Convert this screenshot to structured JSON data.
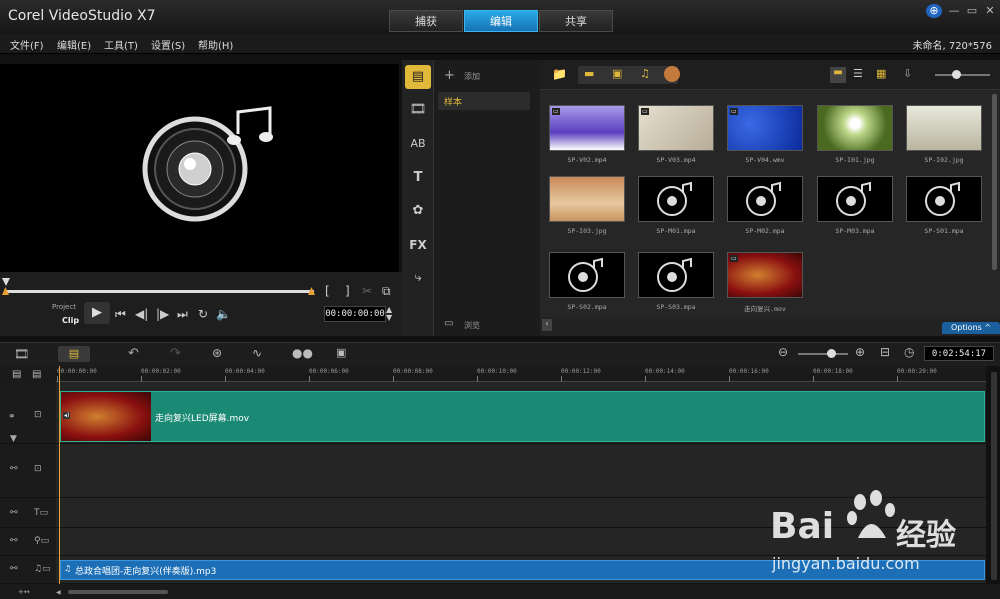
{
  "app": {
    "title": "Corel VideoStudio X7",
    "project_info": "未命名, 720*576"
  },
  "tabs": [
    {
      "label": "捕获",
      "active": false
    },
    {
      "label": "编辑",
      "active": true
    },
    {
      "label": "共享",
      "active": false
    }
  ],
  "menu": [
    "文件(F)",
    "编辑(E)",
    "工具(T)",
    "设置(S)",
    "帮助(H)"
  ],
  "player": {
    "project_label": "Project",
    "clip_label": "Clip",
    "timecode": "00:00:00:00",
    "trim_in": "[",
    "trim_out": "]"
  },
  "library": {
    "add_label": "添加",
    "folder_sample": "样本",
    "browse_label": "浏览",
    "options_label": "Options ^",
    "items": [
      {
        "caption": "SP-V02.mp4",
        "kind": "video",
        "theme": "violet"
      },
      {
        "caption": "SP-V03.mp4",
        "kind": "video",
        "theme": "beige"
      },
      {
        "caption": "SP-V04.wmv",
        "kind": "video",
        "theme": "blue"
      },
      {
        "caption": "SP-I01.jpg",
        "kind": "image",
        "theme": "dandelion"
      },
      {
        "caption": "SP-I02.jpg",
        "kind": "image",
        "theme": "tree"
      },
      {
        "caption": "SP-I03.jpg",
        "kind": "image",
        "theme": "desert"
      },
      {
        "caption": "SP-M01.mpa",
        "kind": "audio",
        "theme": "music"
      },
      {
        "caption": "SP-M02.mpa",
        "kind": "audio",
        "theme": "music"
      },
      {
        "caption": "SP-M03.mpa",
        "kind": "audio",
        "theme": "music"
      },
      {
        "caption": "SP-S01.mpa",
        "kind": "audio",
        "theme": "music"
      },
      {
        "caption": "SP-S02.mpa",
        "kind": "audio",
        "theme": "music"
      },
      {
        "caption": "SP-S03.mpa",
        "kind": "audio",
        "theme": "music"
      },
      {
        "caption": "走向复兴.mov",
        "kind": "video",
        "theme": "red"
      }
    ]
  },
  "timeline": {
    "duration": "0:02:54:17",
    "ticks": [
      "00:00:00:00",
      "00:00:02:00",
      "00:00:04:00",
      "00:00:06:00",
      "00:00:08:00",
      "00:00:10:00",
      "00:00:12:00",
      "00:00:14:00",
      "00:00:16:00",
      "00:00:18:00",
      "00:00:20:00"
    ],
    "video_clip": "走向复兴LED屏幕.mov",
    "audio_clip": "总政合唱团-走向复兴(伴奏版).mp3"
  },
  "watermark": {
    "brand": "Bai",
    "brand2": "经验",
    "url": "jingyan.baidu.com"
  },
  "colors": {
    "accent": "#1e8fd6",
    "video_clip": "#1b8a74",
    "audio_clip": "#1c6fb6",
    "playhead": "#e8a030"
  }
}
